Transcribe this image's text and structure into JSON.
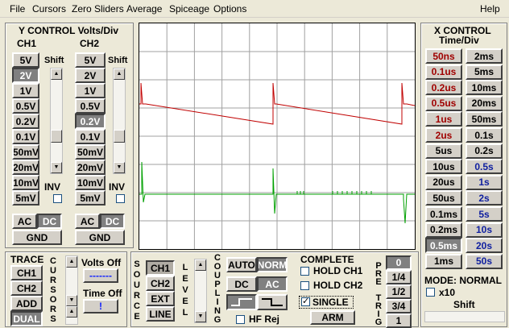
{
  "menu": {
    "file": "File",
    "cursors": "Cursors",
    "zero_sliders": "Zero Sliders",
    "average": "Average",
    "spiceage": "Spiceage",
    "options": "Options",
    "help": "Help"
  },
  "y_control": {
    "title": "Y CONTROL Volts/Div",
    "ch1_label": "CH1",
    "ch2_label": "CH2",
    "shift_label": "Shift",
    "inv_label": "INV",
    "ch1_buttons": [
      "5V",
      "2V",
      "1V",
      "0.5V",
      "0.2V",
      "0.1V",
      "50mV",
      "20mV",
      "10mV",
      "5mV"
    ],
    "ch2_buttons": [
      "5V",
      "2V",
      "1V",
      "0.5V",
      "0.2V",
      "0.1V",
      "50mV",
      "20mV",
      "10mV",
      "5mV"
    ],
    "ch1_selected": "2V",
    "ch2_selected": "0.2V",
    "ac": "AC",
    "dc": "DC",
    "gnd": "GND"
  },
  "x_control": {
    "title": "X CONTROL",
    "subtitle": "Time/Div",
    "left_buttons": [
      "50ns",
      "0.1us",
      "0.2us",
      "0.5us",
      "1us",
      "2us",
      "5us",
      "10us",
      "20us",
      "50us",
      "0.1ms",
      "0.2ms",
      "0.5ms",
      "1ms"
    ],
    "right_buttons": [
      "2ms",
      "5ms",
      "10ms",
      "20ms",
      "50ms",
      "0.1s",
      "0.2s",
      "0.5s",
      "1s",
      "2s",
      "5s",
      "10s",
      "20s",
      "50s"
    ],
    "selected": "0.5ms",
    "mode_label": "MODE: NORMAL",
    "x10_label": "x10",
    "shift_label": "Shift"
  },
  "trace": {
    "title": "TRACE",
    "ch1": "CH1",
    "ch2": "CH2",
    "add": "ADD",
    "dual": "DUAL",
    "cursors_label": [
      "C",
      "U",
      "R",
      "S",
      "O",
      "R",
      "S"
    ],
    "volts_off": "Volts Off",
    "volts_value": "-------",
    "time_off": "Time Off",
    "time_value": "!"
  },
  "trigger": {
    "source_label": [
      "S",
      "O",
      "U",
      "R",
      "C",
      "E"
    ],
    "source_ch1": "CH1",
    "source_ch2": "CH2",
    "source_ext": "EXT",
    "source_line": "LINE",
    "level_label": [
      "L",
      "E",
      "V",
      "E",
      "L"
    ],
    "coupling_label": [
      "C",
      "O",
      "U",
      "P",
      "L",
      "I",
      "N",
      "G"
    ],
    "auto": "AUTO",
    "norm": "NORM",
    "dc": "DC",
    "ac": "AC",
    "hf_rej": "HF Rej",
    "complete": "COMPLETE",
    "hold_ch1": "HOLD CH1",
    "hold_ch2": "HOLD CH2",
    "single": "SINGLE",
    "arm": "ARM",
    "pretrig_label": [
      "P",
      "R",
      "E",
      "",
      "T",
      "R",
      "I",
      "G"
    ],
    "pretrig_buttons": [
      "0",
      "1/4",
      "1/2",
      "3/4",
      "1"
    ],
    "pretrig_selected": "0"
  },
  "colors": {
    "ch1_trace": "#c00000",
    "ch2_trace": "#00a000",
    "grid": "#a0a0a0"
  }
}
